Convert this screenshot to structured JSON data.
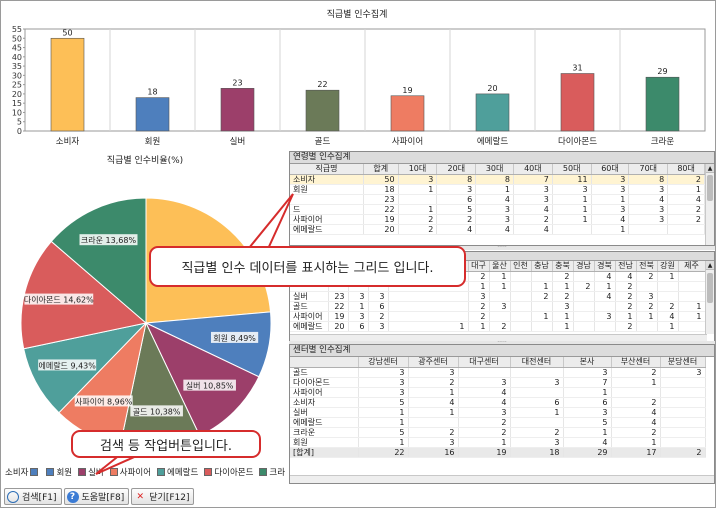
{
  "bar_title": "직급별 인수집계",
  "pie_title": "직급별 인수비율(%)",
  "chart_data": [
    {
      "type": "bar",
      "title": "직급별 인수집계",
      "categories": [
        "소비자",
        "회원",
        "실버",
        "골드",
        "사파이어",
        "에메랄드",
        "다이아몬드",
        "크라운"
      ],
      "values": [
        50,
        18,
        23,
        22,
        19,
        20,
        31,
        29
      ],
      "ylim": [
        0,
        55
      ],
      "yticks": [
        0,
        5,
        10,
        15,
        20,
        25,
        30,
        35,
        40,
        45,
        50,
        55
      ],
      "colors": [
        "#fdbf57",
        "#4e7fbd",
        "#9c3f6a",
        "#6b7a58",
        "#ee7c62",
        "#4f9f9b",
        "#d95c5c",
        "#3c8a6b"
      ],
      "grid": "vertical lines only"
    },
    {
      "type": "pie",
      "title": "직급별 인수비율(%)",
      "categories": [
        "소비자",
        "회원",
        "실버",
        "골드",
        "사파이어",
        "에메랄드",
        "다이아몬드",
        "크라운"
      ],
      "values": [
        23.58,
        8.49,
        10.85,
        10.38,
        8.96,
        9.43,
        14.62,
        13.68
      ],
      "labels": [
        "",
        "회원 8,49%",
        "실버 10,85%",
        "골드 10,38%",
        "사파이어 8,96%",
        "에메랄드 9,43%",
        "다이아몬드 14,62%",
        "크라운 13,68%"
      ],
      "legend": "bottom"
    }
  ],
  "legend_items": [
    "소비자",
    "회원",
    "실버",
    "사파이어",
    "에메랄드",
    "다이아몬드",
    "크라"
  ],
  "grid1": {
    "title": "연령별 인수집계",
    "headers": [
      "직급명",
      "합계",
      "10대",
      "20대",
      "30대",
      "40대",
      "50대",
      "60대",
      "70대",
      "80대"
    ],
    "rows": [
      [
        "소비자",
        "50",
        "3",
        "8",
        "8",
        "7",
        "11",
        "3",
        "8",
        "2"
      ],
      [
        "회원",
        "18",
        "1",
        "3",
        "1",
        "3",
        "3",
        "3",
        "3",
        "1"
      ],
      [
        "",
        "23",
        "",
        "6",
        "4",
        "3",
        "1",
        "1",
        "4",
        "4"
      ],
      [
        "드",
        "22",
        "1",
        "5",
        "3",
        "4",
        "1",
        "3",
        "3",
        "2"
      ],
      [
        "사파이어",
        "19",
        "2",
        "2",
        "3",
        "2",
        "1",
        "4",
        "3",
        "2"
      ],
      [
        "에메랄드",
        "20",
        "2",
        "4",
        "4",
        "4",
        "",
        "1",
        "",
        ""
      ]
    ]
  },
  "grid2": {
    "headers": [
      "",
      "",
      "",
      "",
      "",
      "대구",
      "울산",
      "인천",
      "충남",
      "충북",
      "경남",
      "경북",
      "전남",
      "전북",
      "강원",
      "제주"
    ],
    "rows": [
      [
        "",
        "",
        "",
        "",
        "",
        "2",
        "1",
        "",
        "",
        "2",
        "",
        "4",
        "4",
        "2",
        "1",
        ""
      ],
      [
        "",
        "",
        "",
        "",
        "",
        "1",
        "1",
        "",
        "1",
        "1",
        "2",
        "1",
        "2",
        "",
        "",
        ""
      ],
      [
        "실버",
        "23",
        "3",
        "3",
        "",
        "3",
        "",
        "",
        "2",
        "2",
        "",
        "4",
        "2",
        "3",
        "",
        ""
      ],
      [
        "골드",
        "22",
        "1",
        "6",
        "",
        "2",
        "3",
        "",
        "",
        "3",
        "",
        "",
        "2",
        "2",
        "2",
        "1"
      ],
      [
        "사파이어",
        "19",
        "3",
        "2",
        "",
        "2",
        "",
        "",
        "1",
        "1",
        "",
        "3",
        "1",
        "1",
        "4",
        "1"
      ],
      [
        "에메랄드",
        "20",
        "6",
        "3",
        "1",
        "1",
        "2",
        "",
        "",
        "1",
        "",
        "",
        "2",
        "",
        "1",
        ""
      ]
    ]
  },
  "grid3": {
    "title": "센터별 인수집계",
    "headers": [
      "",
      "강남센터",
      "광주센터",
      "대구센터",
      "대전센터",
      "본사",
      "부산센터",
      "분당센터"
    ],
    "rows": [
      [
        "골드",
        "3",
        "3",
        "",
        "",
        "3",
        "2",
        "3"
      ],
      [
        "다이아몬드",
        "3",
        "2",
        "3",
        "3",
        "7",
        "1",
        ""
      ],
      [
        "사파이어",
        "3",
        "1",
        "4",
        "",
        "1",
        "",
        ""
      ],
      [
        "소비자",
        "5",
        "4",
        "4",
        "6",
        "6",
        "2",
        ""
      ],
      [
        "실버",
        "1",
        "1",
        "3",
        "1",
        "3",
        "4",
        ""
      ],
      [
        "에메랄드",
        "1",
        "",
        "2",
        "",
        "5",
        "4",
        ""
      ],
      [
        "크라운",
        "5",
        "2",
        "2",
        "2",
        "1",
        "2",
        ""
      ],
      [
        "회원",
        "1",
        "3",
        "1",
        "3",
        "4",
        "1",
        ""
      ]
    ],
    "total": [
      "[합계]",
      "22",
      "16",
      "19",
      "18",
      "29",
      "17",
      "2"
    ]
  },
  "callout1": "직급별 인수 데이터를 표시하는 그리드 입니다.",
  "callout2": "검색 등 작업버튼입니다.",
  "toolbar": {
    "search_label": "검색[F1]",
    "help_label": "도움말[F8]",
    "close_label": "닫기[F12]"
  }
}
